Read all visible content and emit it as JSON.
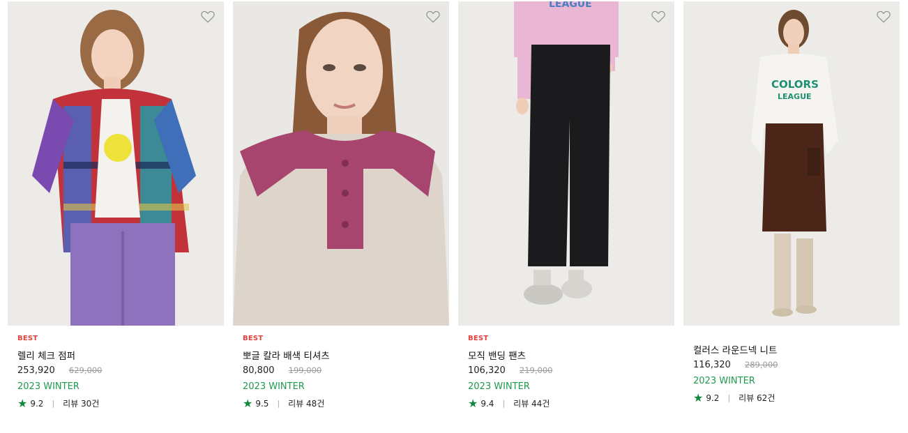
{
  "products": [
    {
      "badge": "BEST",
      "name": "렐리 체크 점퍼",
      "price": "253,920",
      "original_price": "629,000",
      "season": "2023 WINTER",
      "rating": "9.2",
      "reviews": "리뷰 30건"
    },
    {
      "badge": "BEST",
      "name": "뽀글 칼라 배색 티셔츠",
      "price": "80,800",
      "original_price": "199,000",
      "season": "2023 WINTER",
      "rating": "9.5",
      "reviews": "리뷰 48건"
    },
    {
      "badge": "BEST",
      "name": "모직 밴딩 팬츠",
      "price": "106,320",
      "original_price": "219,000",
      "season": "2023 WINTER",
      "rating": "9.4",
      "reviews": "리뷰 44건"
    },
    {
      "badge": "",
      "name": "컬러스 라운드넥 니트",
      "price": "116,320",
      "original_price": "289,000",
      "season": "2023 WINTER",
      "rating": "9.2",
      "reviews": "리뷰 62건"
    }
  ],
  "icons": {
    "wishlist": "heart-outline-icon",
    "rating": "star-icon"
  },
  "colors": {
    "badge": "#e0413d",
    "season": "#1e9a4c",
    "star": "#0f8a3c",
    "original_price": "#9a9a9a"
  }
}
